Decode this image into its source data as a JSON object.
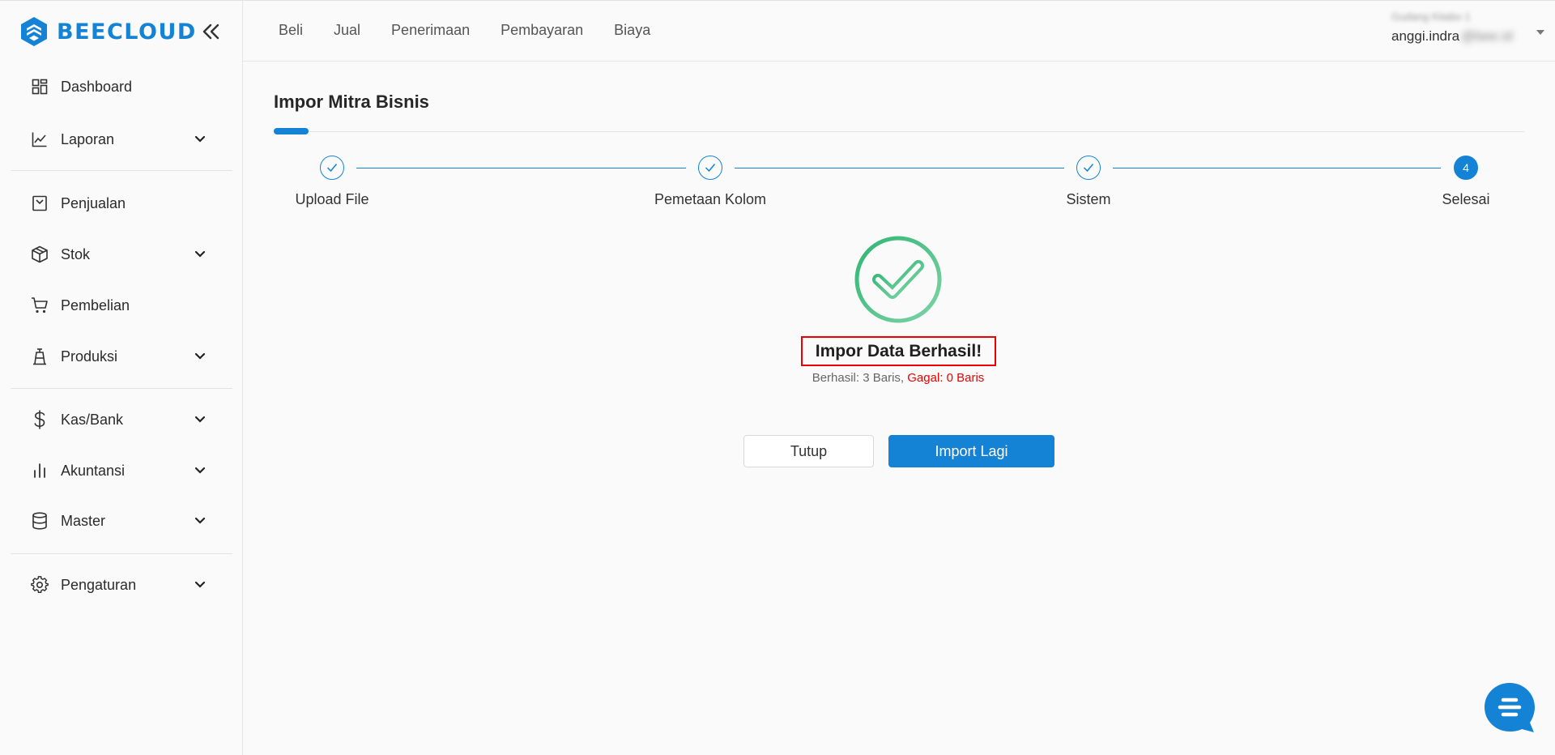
{
  "brand": {
    "name": "BEECLOUD",
    "color": "#1483d6"
  },
  "sidebar": {
    "items": [
      {
        "label": "Dashboard",
        "icon": "grid-icon",
        "expandable": false
      },
      {
        "label": "Laporan",
        "icon": "chart-line-icon",
        "expandable": true
      },
      {
        "label": "Penjualan",
        "icon": "receipt-icon",
        "expandable": false
      },
      {
        "label": "Stok",
        "icon": "box-icon",
        "expandable": true
      },
      {
        "label": "Pembelian",
        "icon": "cart-icon",
        "expandable": false
      },
      {
        "label": "Produksi",
        "icon": "factory-icon",
        "expandable": true
      },
      {
        "label": "Kas/Bank",
        "icon": "dollar-icon",
        "expandable": true
      },
      {
        "label": "Akuntansi",
        "icon": "bar-chart-icon",
        "expandable": true
      },
      {
        "label": "Master",
        "icon": "database-icon",
        "expandable": true
      },
      {
        "label": "Pengaturan",
        "icon": "gear-icon",
        "expandable": true
      }
    ]
  },
  "topbar": {
    "menu": [
      "Beli",
      "Jual",
      "Penerimaan",
      "Pembayaran",
      "Biaya"
    ],
    "user": {
      "company": "Gudang Kitabo 1",
      "email_visible": "anggi.indra",
      "email_hidden": "@bee.id"
    }
  },
  "page": {
    "title": "Impor Mitra Bisnis"
  },
  "stepper": {
    "steps": [
      {
        "label": "Upload File",
        "state": "done"
      },
      {
        "label": "Pemetaan Kolom",
        "state": "done"
      },
      {
        "label": "Sistem",
        "state": "done"
      },
      {
        "label": "Selesai",
        "state": "active",
        "number": "4"
      }
    ]
  },
  "result": {
    "title": "Impor Data Berhasil!",
    "success_text": "Berhasil: 3 Baris,",
    "fail_text": "Gagal: 0 Baris"
  },
  "buttons": {
    "close": "Tutup",
    "again": "Import Lagi"
  },
  "colors": {
    "accent": "#1483d6",
    "success": "#3dbb7a",
    "error": "#e00000"
  }
}
